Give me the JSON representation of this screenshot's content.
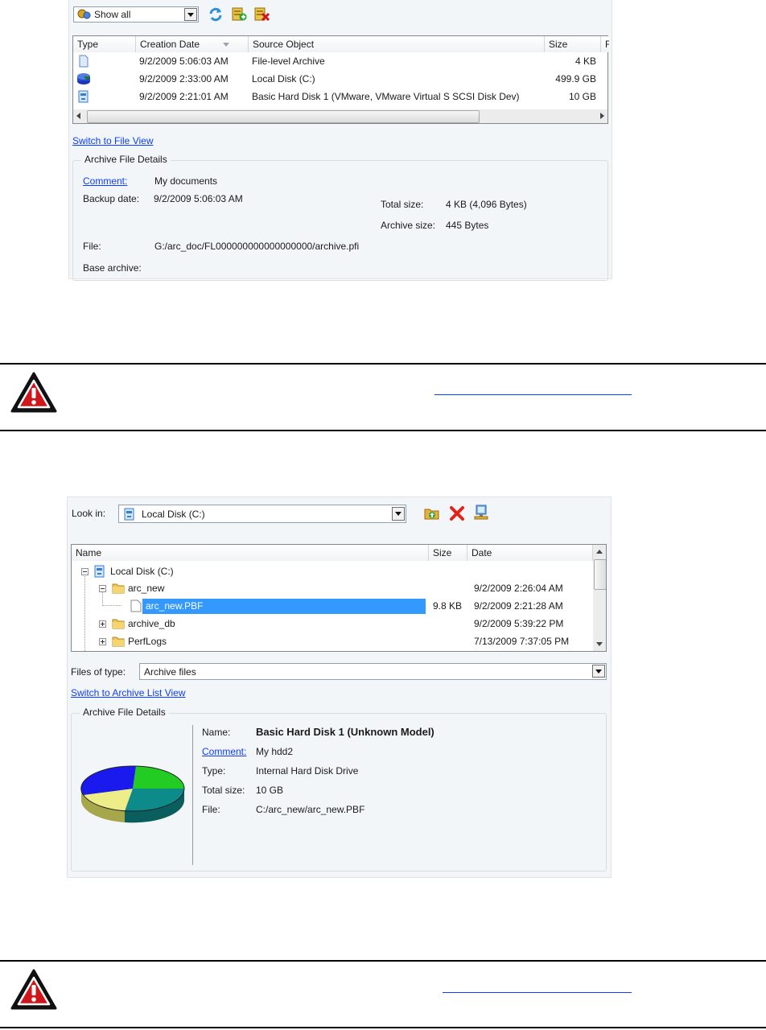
{
  "panel1": {
    "filter": {
      "value": "Show all"
    },
    "columns": [
      "Type",
      "Creation Date",
      "Source Object",
      "Size",
      "F"
    ],
    "rows": [
      {
        "date": "9/2/2009 5:06:03 AM",
        "source": "File-level Archive",
        "size": "4 KB",
        "icon": "file-archive-icon"
      },
      {
        "date": "9/2/2009 2:33:00 AM",
        "source": "Local Disk (C:)",
        "size": "499.9 GB",
        "icon": "local-disk-icon"
      },
      {
        "date": "9/2/2009 2:21:01 AM",
        "source": "Basic Hard Disk 1 (VMware, VMware Virtual S SCSI Disk Dev)",
        "size": "10 GB",
        "icon": "hard-disk-icon"
      }
    ],
    "switch_link": "Switch to File View",
    "details": {
      "title": "Archive File Details",
      "comment_label": "Comment:",
      "comment": "My documents",
      "backup_label": "Backup date:",
      "backup": "9/2/2009 5:06:03 AM",
      "total_label": "Total size:",
      "total": "4 KB (4,096 Bytes)",
      "archive_label": "Archive size:",
      "archive": "445 Bytes",
      "file_label": "File:",
      "file": "G:/arc_doc/FL000000000000000000/archive.pfi",
      "base_label": "Base archive:"
    }
  },
  "panel2": {
    "look_in_label": "Look in:",
    "look_in_value": "Local Disk (C:)",
    "columns": [
      "Name",
      "Size",
      "Date"
    ],
    "tree": [
      {
        "name": "Local Disk (C:)",
        "size": "",
        "date": ""
      },
      {
        "name": "arc_new",
        "size": "",
        "date": "9/2/2009 2:26:04 AM"
      },
      {
        "name": "arc_new.PBF",
        "size": "9.8 KB",
        "date": "9/2/2009 2:21:28 AM"
      },
      {
        "name": "archive_db",
        "size": "",
        "date": "9/2/2009 5:39:22 PM"
      },
      {
        "name": "PerfLogs",
        "size": "",
        "date": "7/13/2009 7:37:05 PM"
      }
    ],
    "files_of_type_label": "Files of type:",
    "files_of_type_value": "Archive files",
    "switch_link": "Switch to Archive List View",
    "details": {
      "title": "Archive File Details",
      "name_label": "Name:",
      "name": "Basic Hard Disk 1 (Unknown Model)",
      "comment_label": "Comment:",
      "comment": "My hdd2",
      "type_label": "Type:",
      "type": "Internal Hard Disk Drive",
      "total_label": "Total size:",
      "total": "10 GB",
      "file_label": "File:",
      "file": "C:/arc_new/arc_new.PBF"
    }
  },
  "colors": {
    "link": "#0b3cff",
    "selection": "#3399ff",
    "warning_red": "#d0161b",
    "pie_green": "#22cc22",
    "pie_teal": "#0d8a8a",
    "pie_yellow": "#eeee88",
    "pie_blue": "#1a1aee"
  }
}
